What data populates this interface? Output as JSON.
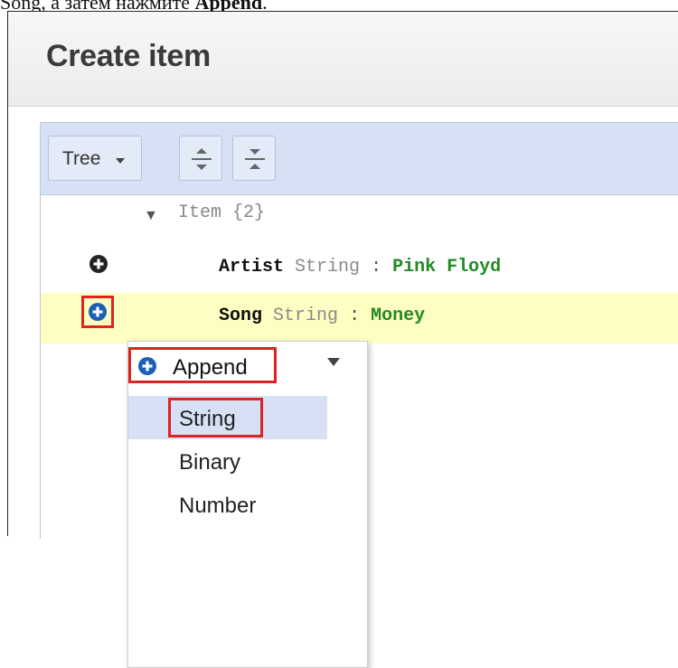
{
  "caption": {
    "text_before": "Song, a затем нажмите ",
    "bold": "Append",
    "text_after": "."
  },
  "dialog": {
    "title": "Create item"
  },
  "toolbar": {
    "view_mode": "Tree",
    "expand_icon": "expand-all-icon",
    "collapse_icon": "collapse-all-icon"
  },
  "tree": {
    "root": {
      "arrow": "▼",
      "label": "Item {2}"
    },
    "rows": [
      {
        "name": "Artist",
        "type": "String",
        "sep": ":",
        "value": "Pink Floyd",
        "highlighted": false
      },
      {
        "name": "Song",
        "type": "String",
        "sep": ":",
        "value": "Money",
        "highlighted": true
      }
    ]
  },
  "context_menu": {
    "append_label": "Append",
    "append_icon": "plus-circle-icon",
    "types": [
      "String",
      "Binary",
      "Number"
    ],
    "active_type": "String"
  },
  "colors": {
    "highlight_row": "#fefdc2",
    "annotation_red": "#e0231f",
    "value_green": "#238b23",
    "toolbar_blue": "#d6e1f5",
    "plus_blue": "#1c5fb3"
  }
}
